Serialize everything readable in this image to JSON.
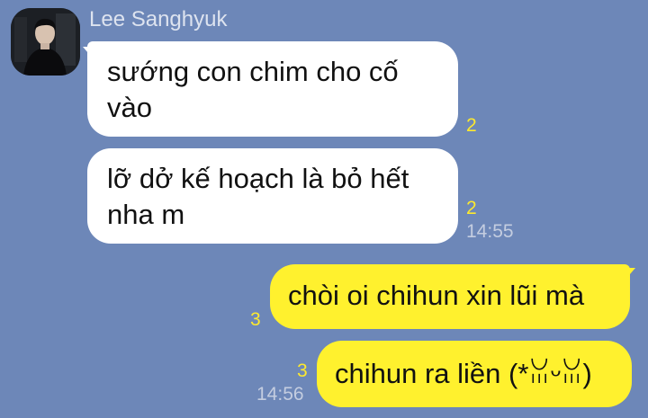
{
  "chat": {
    "sender_name": "Lee Sanghyuk",
    "messages": [
      {
        "text": "sướng con chim cho cố vào",
        "unread": "2",
        "time": ""
      },
      {
        "text": "lỡ dở kế hoạch là bỏ hết nha m",
        "unread": "2",
        "time": "14:55"
      },
      {
        "text": "chòi oi chihun xin lũi mà",
        "unread": "3",
        "time": ""
      },
      {
        "text": "chihun ra liền (*ꈍᵕꈍ)",
        "unread": "3",
        "time": "14:56"
      }
    ]
  },
  "colors": {
    "background": "#6d87b8",
    "incoming_bubble": "#ffffff",
    "outgoing_bubble": "#fff12e",
    "unread_count": "#fde92e"
  },
  "icons": {
    "avatar": "profile-photo-person"
  }
}
